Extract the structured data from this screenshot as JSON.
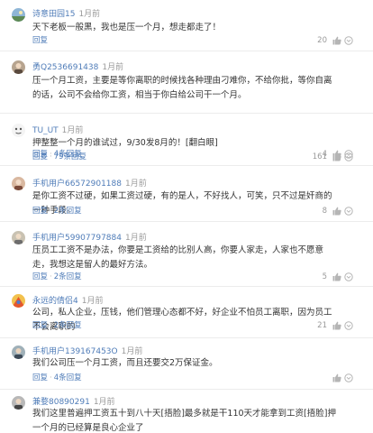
{
  "colors": {
    "link": "#4f7cb8",
    "text": "#333333",
    "meta": "#9a9a9a",
    "icon": "#b5b5b5"
  },
  "comments": [
    {
      "username": "诗意田园15",
      "time": "1月前",
      "content": "天下老板一般黑，我也是压一个月，想走都走了！",
      "reply_label": "回复",
      "replies_label": "",
      "likes": "20",
      "avatar": "landscape-avatar"
    },
    {
      "username": "勇Q2536691438",
      "time": "1月前",
      "content": "压一个月工资，主要是等你离职的时候找各种理由刁难你，不给你批，等你自离的话，公司不会给你工资，相当于你白给公司干一个月。",
      "reply_label": "回复",
      "replies_label": "4条回复",
      "likes": "4",
      "avatar": "portrait-avatar"
    },
    {
      "username": "TU_UT",
      "time": "1月前",
      "content": "押整整一个月的谁试过，9/30发8月的！[翻白眼]",
      "reply_label": "回复",
      "replies_label": "79条回复",
      "likes": "161",
      "avatar": "cartoon-avatar"
    },
    {
      "username": "手机用户66572901188",
      "time": "1月前",
      "content": "是你工资不过硬，如果工资过硬，有的是人，不好找人，可笑，只不过是奸商的一种手段。",
      "reply_label": "回复",
      "replies_label": "2条回复",
      "likes": "8",
      "avatar": "portrait-avatar"
    },
    {
      "username": "手机用户59907797884",
      "time": "1月前",
      "content": "压员工工资不是办法，你要是工资给的比别人高，你要人家走，人家也不愿意走，我想这是留人的最好方法。",
      "reply_label": "回复",
      "replies_label": "2条回复",
      "likes": "5",
      "avatar": "portrait-avatar"
    },
    {
      "username": "永远的倩侣4",
      "time": "1月前",
      "content": "公司，私人企业，压钱，他们管理心态都不好，好企业不怕员工离职，因为员工不会离职的",
      "reply_label": "回复",
      "replies_label": "2条回复",
      "likes": "21",
      "avatar": "colorful-avatar"
    },
    {
      "username": "手机用户139167453O",
      "time": "1月前",
      "content": "我们公司压一个月工资，而且还要交2万保证金。",
      "reply_label": "回复",
      "replies_label": "4条回复",
      "likes": "",
      "avatar": "portrait-avatar"
    },
    {
      "username": "兼婺80890291",
      "time": "1月前",
      "content": "我们这里普遍押工资五十到八十天[捂脸]最多就是干110天才能拿到工资[捂脸]押一个月的已经算是良心企业了",
      "reply_label": "",
      "replies_label": "",
      "likes": "",
      "avatar": "portrait-avatar"
    }
  ]
}
